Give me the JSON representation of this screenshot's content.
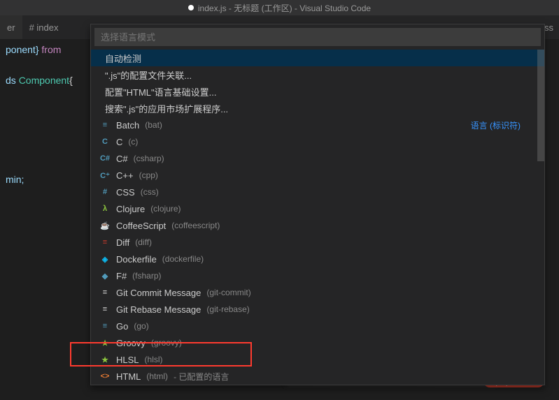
{
  "titlebar": {
    "text": "index.js - 无标题 (工作区) - Visual Studio Code"
  },
  "tabs": {
    "partial_left_label": "er",
    "open_file_prefix": "# index",
    "partial_right_label": "ess"
  },
  "editor": {
    "line1_prefix": "ponent} ",
    "line1_kw": "from",
    "line2_prefix": "ds ",
    "line2_cls": "Component",
    "line2_sym": "{",
    "line3": "min;"
  },
  "picker": {
    "placeholder": "选择语言模式",
    "header_link": "语言 (标识符)",
    "items": [
      {
        "icon": "",
        "iconClass": "",
        "label": "自动检测",
        "detail": "",
        "extra": "",
        "selected": true
      },
      {
        "icon": "",
        "iconClass": "",
        "label": "\".js\"的配置文件关联...",
        "detail": "",
        "extra": ""
      },
      {
        "icon": "",
        "iconClass": "",
        "label": "配置\"HTML\"语言基础设置...",
        "detail": "",
        "extra": ""
      },
      {
        "icon": "",
        "iconClass": "",
        "label": "搜索\".js\"的应用市场扩展程序...",
        "detail": "",
        "extra": ""
      },
      {
        "icon": "≡",
        "iconClass": "icon-hash",
        "label": "Batch",
        "detail": "(bat)",
        "extra": ""
      },
      {
        "icon": "C",
        "iconClass": "icon-c",
        "label": "C",
        "detail": "(c)",
        "extra": ""
      },
      {
        "icon": "C#",
        "iconClass": "icon-cs",
        "label": "C#",
        "detail": "(csharp)",
        "extra": ""
      },
      {
        "icon": "C⁺",
        "iconClass": "icon-c",
        "label": "C++",
        "detail": "(cpp)",
        "extra": ""
      },
      {
        "icon": "#",
        "iconClass": "icon-css",
        "label": "CSS",
        "detail": "(css)",
        "extra": ""
      },
      {
        "icon": "λ",
        "iconClass": "icon-clj",
        "label": "Clojure",
        "detail": "(clojure)",
        "extra": ""
      },
      {
        "icon": "☕",
        "iconClass": "icon-coffee",
        "label": "CoffeeScript",
        "detail": "(coffeescript)",
        "extra": ""
      },
      {
        "icon": "≡",
        "iconClass": "icon-diff",
        "label": "Diff",
        "detail": "(diff)",
        "extra": ""
      },
      {
        "icon": "◈",
        "iconClass": "icon-docker",
        "label": "Dockerfile",
        "detail": "(dockerfile)",
        "extra": ""
      },
      {
        "icon": "◆",
        "iconClass": "icon-fs",
        "label": "F#",
        "detail": "(fsharp)",
        "extra": ""
      },
      {
        "icon": "≡",
        "iconClass": "icon-git",
        "label": "Git Commit Message",
        "detail": "(git-commit)",
        "extra": ""
      },
      {
        "icon": "≡",
        "iconClass": "icon-git",
        "label": "Git Rebase Message",
        "detail": "(git-rebase)",
        "extra": ""
      },
      {
        "icon": "≡",
        "iconClass": "icon-go",
        "label": "Go",
        "detail": "(go)",
        "extra": ""
      },
      {
        "icon": "★",
        "iconClass": "icon-groovy",
        "label": "Groovy",
        "detail": "(groovy)",
        "extra": ""
      },
      {
        "icon": "★",
        "iconClass": "icon-hlsl",
        "label": "HLSL",
        "detail": "(hlsl)",
        "extra": ""
      },
      {
        "icon": "<>",
        "iconClass": "icon-html",
        "label": "HTML",
        "detail": "(html)",
        "extra": " - 已配置的语言"
      }
    ]
  },
  "watermark": "php中文网"
}
